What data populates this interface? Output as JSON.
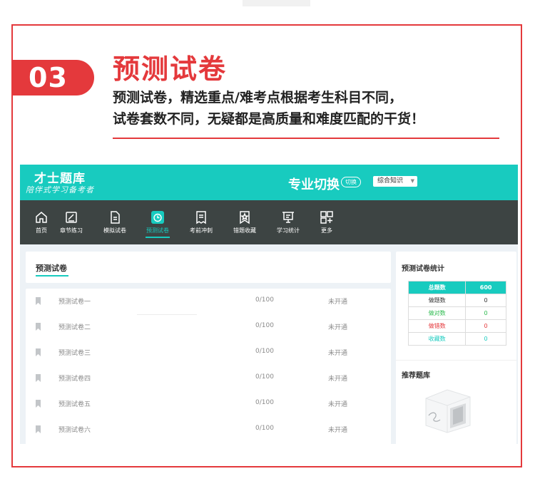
{
  "badge": {
    "number": "03"
  },
  "heading": {
    "title": "预测试卷",
    "line1": "预测试卷，精选重点/难考点根据考生科目不同，",
    "line2": "试卷套数不同，无疑都是高质量和难度匹配的干货！"
  },
  "app": {
    "logo": "才士题库",
    "slogan": "陪伴式学习备考者",
    "switch_title": "专业切换",
    "switch_button": "切换",
    "select_value": "综合知识",
    "nav": [
      {
        "label": "首页",
        "icon": "home-icon"
      },
      {
        "label": "章节练习",
        "icon": "edit-icon"
      },
      {
        "label": "模拟试卷",
        "icon": "document-icon"
      },
      {
        "label": "预测试卷",
        "icon": "clock-icon"
      },
      {
        "label": "考前冲刺",
        "icon": "receipt-icon"
      },
      {
        "label": "错题收藏",
        "icon": "star-icon"
      },
      {
        "label": "学习统计",
        "icon": "presentation-icon"
      },
      {
        "label": "更多",
        "icon": "grid-plus-icon"
      }
    ],
    "active_nav": "预测试卷",
    "section_title": "预测试卷",
    "papers": [
      {
        "name": "预测试卷一",
        "score": "0/100",
        "status": "未开通"
      },
      {
        "name": "预测试卷二",
        "score": "0/100",
        "status": "未开通"
      },
      {
        "name": "预测试卷三",
        "score": "0/100",
        "status": "未开通"
      },
      {
        "name": "预测试卷四",
        "score": "0/100",
        "status": "未开通"
      },
      {
        "name": "预测试卷五",
        "score": "0/100",
        "status": "未开通"
      },
      {
        "name": "预测试卷六",
        "score": "0/100",
        "status": "未开通"
      }
    ],
    "stats_title": "预测试卷统计",
    "stats": {
      "total_label": "总题数",
      "total_value": "600",
      "done_label": "做题数",
      "done_value": "0",
      "correct_label": "做对数",
      "correct_value": "0",
      "wrong_label": "做错数",
      "wrong_value": "0",
      "fav_label": "收藏数",
      "fav_value": "0"
    },
    "recommend_title": "推荐题库"
  },
  "colors": {
    "accent_red": "#e4393c",
    "teal": "#18cbbf",
    "nav_dark": "#3d4443",
    "wrong_red": "#e4393c",
    "correct_green": "#2dbb4f"
  }
}
